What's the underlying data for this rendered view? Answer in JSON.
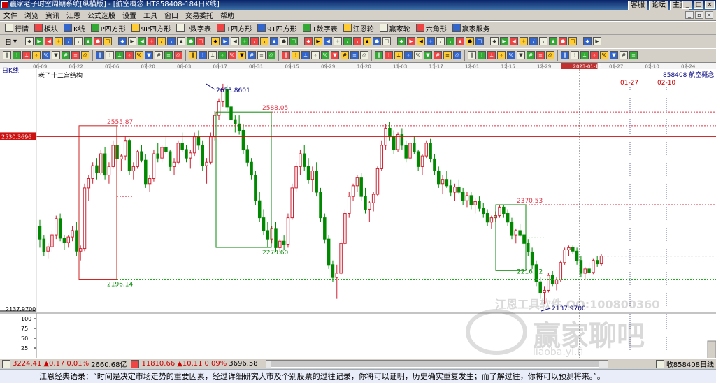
{
  "app": {
    "title": "赢家老子时空周期系统[纵横版] - [航空概念  HT858408-184日K线]",
    "links": [
      "客服",
      "论坛",
      "主页"
    ]
  },
  "menu": [
    "文件",
    "浏览",
    "资讯",
    "江恩",
    "公式选股",
    "设置",
    "工具",
    "窗口",
    "交易委托",
    "帮助"
  ],
  "toolbar1": [
    {
      "icon": "grid-icon",
      "label": "行情"
    },
    {
      "icon": "block-icon",
      "label": "板块"
    },
    {
      "icon": "kline-icon",
      "label": "K线"
    },
    {
      "icon": "p-square-icon",
      "label": "P四方形"
    },
    {
      "icon": "9p-square-icon",
      "label": "9P四方形"
    },
    {
      "icon": "p-number-icon",
      "label": "P数字表"
    },
    {
      "icon": "t-square-icon",
      "label": "T四方形"
    },
    {
      "icon": "9t-square-icon",
      "label": "9T四方形"
    },
    {
      "icon": "t-number-icon",
      "label": "T数字表"
    },
    {
      "icon": "gann-wheel-icon",
      "label": "江恩轮"
    },
    {
      "icon": "winner-wheel-icon",
      "label": "赢家轮"
    },
    {
      "icon": "hexagon-icon",
      "label": "六角形"
    },
    {
      "icon": "service-icon",
      "label": "赢家服务"
    }
  ],
  "toolbar2": {
    "period": "日"
  },
  "chart": {
    "period_label": "日K线",
    "indicator_label": "老子十二宫结构",
    "code": "858408",
    "name": "航空概念",
    "price_marker": "2530.3696",
    "low_label": "2137.9700",
    "axis_dates": [
      "06-09",
      "06-22",
      "07-06",
      "07-20",
      "08-03",
      "08-17",
      "08-31",
      "09-15",
      "09-29",
      "10-20",
      "11-03",
      "11-17",
      "12-01",
      "12-15",
      "12-29",
      "2023-01-10",
      "01-27",
      "02-10",
      "02-24"
    ],
    "future_dates": [
      "01-27",
      "02-10"
    ],
    "levels": {
      "l2653": "2653.8601",
      "l2588": "2588.05",
      "l2555": "2555.87",
      "l2370": "2370.53",
      "l2270": "2270.60",
      "l2216": "2216.12",
      "l2196": "2196.14",
      "l2137": "2137.9700"
    },
    "sub_ticks": [
      "100",
      "75",
      "50",
      "25"
    ],
    "watermark": {
      "line1": "江恩工具软件  QQ:100800360",
      "brand": "赢家聊吧",
      "url": "liaoba.yi.fi"
    }
  },
  "status": {
    "idx1": "3224.41",
    "chg1": "▲0.17",
    "pct1": "0.01%",
    "amt1": "2660.68亿",
    "idx2": "11810.66",
    "chg2": "▲10.11",
    "pct2": "0.09%",
    "amt2": "3696.58",
    "right": "收858408日线"
  },
  "quote": "江恩经典语录：“时间是决定市场走势的重要因素，经过详细研究大市及个别股票的过往记录，你将可以证明，历史确实重复发生；而了解过往，你将可以预测将来。”。",
  "colors": {
    "up": "#cc2233",
    "down": "#008800",
    "box": "#0a8a0a",
    "redbox": "#cc2222",
    "dash_red": "#dd3344",
    "dash_green": "#22aa22",
    "blue_text": "#000080"
  },
  "chart_data": {
    "type": "candlestick",
    "series_name": "航空概念 858408 日K线",
    "ylim": [
      2137.97,
      2653.86
    ],
    "candles": [
      [
        2320,
        2335,
        2270,
        2290
      ],
      [
        2290,
        2300,
        2250,
        2260
      ],
      [
        2262,
        2280,
        2245,
        2272
      ],
      [
        2272,
        2310,
        2260,
        2300
      ],
      [
        2300,
        2345,
        2290,
        2338
      ],
      [
        2338,
        2350,
        2285,
        2292
      ],
      [
        2292,
        2300,
        2265,
        2282
      ],
      [
        2282,
        2300,
        2270,
        2295
      ],
      [
        2295,
        2320,
        2285,
        2310
      ],
      [
        2310,
        2330,
        2250,
        2262
      ],
      [
        2262,
        2275,
        2240,
        2268
      ],
      [
        2268,
        2420,
        2262,
        2410
      ],
      [
        2410,
        2440,
        2380,
        2432
      ],
      [
        2432,
        2470,
        2420,
        2462
      ],
      [
        2462,
        2480,
        2430,
        2445
      ],
      [
        2445,
        2500,
        2440,
        2490
      ],
      [
        2490,
        2505,
        2430,
        2440
      ],
      [
        2440,
        2470,
        2420,
        2460
      ],
      [
        2460,
        2520,
        2455,
        2510
      ],
      [
        2510,
        2535,
        2470,
        2478
      ],
      [
        2478,
        2490,
        2450,
        2485
      ],
      [
        2485,
        2530,
        2475,
        2520
      ],
      [
        2520,
        2525,
        2440,
        2450
      ],
      [
        2450,
        2470,
        2430,
        2460
      ],
      [
        2460,
        2500,
        2455,
        2495
      ],
      [
        2495,
        2510,
        2470,
        2475
      ],
      [
        2475,
        2490,
        2410,
        2420
      ],
      [
        2420,
        2440,
        2400,
        2432
      ],
      [
        2432,
        2500,
        2425,
        2490
      ],
      [
        2490,
        2515,
        2470,
        2480
      ],
      [
        2480,
        2510,
        2470,
        2505
      ],
      [
        2505,
        2530,
        2490,
        2495
      ],
      [
        2495,
        2500,
        2450,
        2460
      ],
      [
        2460,
        2480,
        2440,
        2470
      ],
      [
        2470,
        2520,
        2465,
        2515
      ],
      [
        2515,
        2540,
        2495,
        2500
      ],
      [
        2500,
        2510,
        2470,
        2480
      ],
      [
        2480,
        2500,
        2455,
        2492
      ],
      [
        2492,
        2540,
        2485,
        2530
      ],
      [
        2530,
        2545,
        2500,
        2510
      ],
      [
        2510,
        2520,
        2450,
        2462
      ],
      [
        2462,
        2480,
        2420,
        2470
      ],
      [
        2470,
        2540,
        2465,
        2530
      ],
      [
        2530,
        2590,
        2520,
        2580
      ],
      [
        2580,
        2620,
        2570,
        2612
      ],
      [
        2612,
        2654,
        2600,
        2640
      ],
      [
        2640,
        2650,
        2590,
        2600
      ],
      [
        2600,
        2610,
        2560,
        2570
      ],
      [
        2570,
        2580,
        2540,
        2560
      ],
      [
        2560,
        2580,
        2535,
        2545
      ],
      [
        2545,
        2560,
        2490,
        2500
      ],
      [
        2500,
        2510,
        2460,
        2470
      ],
      [
        2470,
        2480,
        2430,
        2440
      ],
      [
        2440,
        2450,
        2370,
        2380
      ],
      [
        2380,
        2400,
        2330,
        2340
      ],
      [
        2340,
        2360,
        2300,
        2310
      ],
      [
        2310,
        2330,
        2270,
        2290
      ],
      [
        2290,
        2320,
        2280,
        2315
      ],
      [
        2315,
        2330,
        2260,
        2270
      ],
      [
        2270,
        2290,
        2260,
        2285
      ],
      [
        2285,
        2300,
        2265,
        2278
      ],
      [
        2278,
        2350,
        2270,
        2340
      ],
      [
        2340,
        2420,
        2335,
        2410
      ],
      [
        2410,
        2470,
        2400,
        2460
      ],
      [
        2460,
        2500,
        2440,
        2490
      ],
      [
        2490,
        2510,
        2450,
        2460
      ],
      [
        2460,
        2480,
        2420,
        2430
      ],
      [
        2430,
        2460,
        2400,
        2450
      ],
      [
        2450,
        2470,
        2390,
        2400
      ],
      [
        2400,
        2410,
        2330,
        2340
      ],
      [
        2340,
        2350,
        2280,
        2290
      ],
      [
        2290,
        2300,
        2220,
        2230
      ],
      [
        2230,
        2240,
        2190,
        2200
      ],
      [
        2200,
        2230,
        2150,
        2210
      ],
      [
        2210,
        2290,
        2205,
        2280
      ],
      [
        2280,
        2360,
        2275,
        2350
      ],
      [
        2350,
        2400,
        2340,
        2390
      ],
      [
        2390,
        2420,
        2380,
        2415
      ],
      [
        2415,
        2440,
        2400,
        2435
      ],
      [
        2435,
        2445,
        2380,
        2390
      ],
      [
        2390,
        2410,
        2350,
        2360
      ],
      [
        2360,
        2380,
        2330,
        2375
      ],
      [
        2375,
        2400,
        2355,
        2395
      ],
      [
        2395,
        2460,
        2390,
        2455
      ],
      [
        2455,
        2520,
        2450,
        2510
      ],
      [
        2510,
        2560,
        2500,
        2550
      ],
      [
        2550,
        2565,
        2520,
        2530
      ],
      [
        2530,
        2545,
        2490,
        2500
      ],
      [
        2500,
        2540,
        2495,
        2535
      ],
      [
        2535,
        2550,
        2500,
        2510
      ],
      [
        2510,
        2520,
        2470,
        2480
      ],
      [
        2480,
        2520,
        2470,
        2515
      ],
      [
        2515,
        2530,
        2490,
        2495
      ],
      [
        2495,
        2500,
        2450,
        2460
      ],
      [
        2460,
        2490,
        2440,
        2485
      ],
      [
        2485,
        2520,
        2480,
        2515
      ],
      [
        2515,
        2525,
        2470,
        2478
      ],
      [
        2478,
        2490,
        2440,
        2450
      ],
      [
        2450,
        2460,
        2410,
        2420
      ],
      [
        2420,
        2440,
        2395,
        2430
      ],
      [
        2430,
        2450,
        2410,
        2415
      ],
      [
        2415,
        2430,
        2390,
        2400
      ],
      [
        2400,
        2420,
        2380,
        2412
      ],
      [
        2412,
        2430,
        2395,
        2400
      ],
      [
        2400,
        2410,
        2370,
        2380
      ],
      [
        2380,
        2400,
        2365,
        2392
      ],
      [
        2392,
        2400,
        2360,
        2370
      ],
      [
        2370,
        2385,
        2350,
        2378
      ],
      [
        2378,
        2390,
        2355,
        2362
      ],
      [
        2362,
        2375,
        2340,
        2350
      ],
      [
        2350,
        2360,
        2320,
        2330
      ],
      [
        2330,
        2345,
        2315,
        2340
      ],
      [
        2340,
        2355,
        2330,
        2345
      ],
      [
        2345,
        2370,
        2340,
        2365
      ],
      [
        2365,
        2371,
        2340,
        2350
      ],
      [
        2350,
        2360,
        2320,
        2330
      ],
      [
        2330,
        2340,
        2290,
        2300
      ],
      [
        2300,
        2315,
        2280,
        2310
      ],
      [
        2310,
        2325,
        2295,
        2300
      ],
      [
        2300,
        2310,
        2270,
        2280
      ],
      [
        2280,
        2290,
        2250,
        2260
      ],
      [
        2260,
        2270,
        2220,
        2230
      ],
      [
        2230,
        2240,
        2180,
        2190
      ],
      [
        2190,
        2200,
        2150,
        2165
      ],
      [
        2165,
        2180,
        2138,
        2170
      ],
      [
        2170,
        2210,
        2165,
        2205
      ],
      [
        2205,
        2215,
        2180,
        2185
      ],
      [
        2185,
        2200,
        2170,
        2195
      ],
      [
        2195,
        2240,
        2190,
        2235
      ],
      [
        2235,
        2270,
        2230,
        2265
      ],
      [
        2265,
        2275,
        2250,
        2270
      ],
      [
        2270,
        2275,
        2255,
        2262
      ],
      [
        2262,
        2270,
        2230,
        2240
      ],
      [
        2240,
        2250,
        2200,
        2210
      ],
      [
        2210,
        2225,
        2195,
        2220
      ],
      [
        2220,
        2235,
        2205,
        2212
      ],
      [
        2212,
        2245,
        2208,
        2240
      ],
      [
        2240,
        2250,
        2225,
        2232
      ],
      [
        2232,
        2255,
        2228,
        2250
      ]
    ]
  }
}
